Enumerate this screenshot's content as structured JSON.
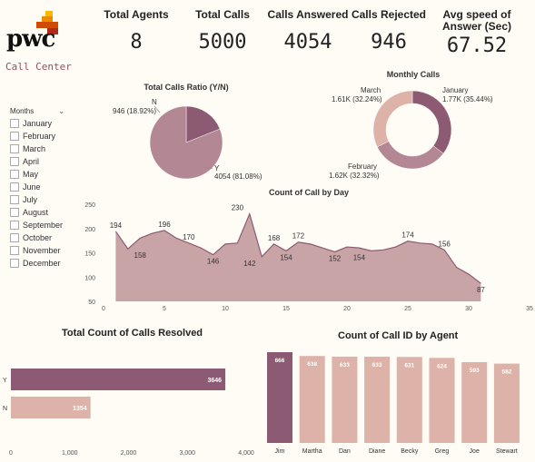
{
  "brand": {
    "logo_text": "pwc",
    "subtitle": "Call Center",
    "colors": {
      "red": "#d04a02",
      "orange": "#eb8c00",
      "yellow": "#ffb600",
      "dark": "#b02a1c"
    }
  },
  "kpis": [
    {
      "label": "Total Agents",
      "value": "8"
    },
    {
      "label": "Total Calls",
      "value": "5000"
    },
    {
      "label": "Calls Answered",
      "value": "4054"
    },
    {
      "label": "Calls Rejected",
      "value": "946"
    },
    {
      "label": "Avg speed of Answer (Sec)",
      "value": "67.52"
    }
  ],
  "slicer": {
    "title": "Months",
    "items": [
      "January",
      "February",
      "March",
      "April",
      "May",
      "June",
      "July",
      "August",
      "September",
      "October",
      "November",
      "December"
    ]
  },
  "colors": {
    "dark": "#8c5a72",
    "mid": "#b48795",
    "light": "#ddb2a8",
    "area": "#c9a4a6",
    "line": "#8c5a72"
  },
  "chart_data": [
    {
      "type": "pie",
      "title": "Total Calls Ratio (Y/N)",
      "categories": [
        "N",
        "Y"
      ],
      "values": [
        946,
        4054
      ],
      "labels": [
        "946 (18.92%)",
        "4054 (81.08%)"
      ]
    },
    {
      "type": "pie",
      "title": "Monthly Calls",
      "categories": [
        "January",
        "February",
        "March"
      ],
      "values": [
        1.77,
        1.62,
        1.61
      ],
      "labels": [
        "1.77K (35.44%)",
        "1.62K (32.32%)",
        "1.61K (32.24%)"
      ]
    },
    {
      "type": "area",
      "title": "Count of Call by Day",
      "x": [
        1,
        2,
        3,
        4,
        5,
        6,
        7,
        8,
        9,
        10,
        11,
        12,
        13,
        14,
        15,
        16,
        17,
        18,
        19,
        20,
        21,
        22,
        23,
        24,
        25,
        26,
        27,
        28,
        29,
        30,
        31
      ],
      "values": [
        194,
        158,
        180,
        190,
        196,
        180,
        170,
        160,
        146,
        168,
        170,
        230,
        142,
        168,
        154,
        172,
        168,
        160,
        152,
        162,
        160,
        154,
        156,
        162,
        174,
        170,
        168,
        156,
        120,
        106,
        87
      ],
      "labels": [
        "194",
        "158",
        "196",
        "170",
        "146",
        "230",
        "142",
        "168",
        "154",
        "172",
        "152",
        "154",
        "174",
        "156",
        "87"
      ],
      "label_x": [
        1,
        3,
        5,
        7,
        9,
        11,
        12,
        14,
        15,
        16,
        19,
        21,
        25,
        28,
        31
      ],
      "label_y": [
        194,
        158,
        196,
        170,
        146,
        230,
        142,
        168,
        154,
        172,
        152,
        154,
        174,
        156,
        87
      ],
      "xlim": [
        0,
        35
      ],
      "ylim": [
        50,
        250
      ],
      "xticks": [
        "0",
        "5",
        "10",
        "15",
        "20",
        "25",
        "30",
        "35"
      ],
      "yticks": [
        "50",
        "100",
        "150",
        "200",
        "250"
      ]
    },
    {
      "type": "bar",
      "orientation": "horizontal",
      "title": "Total Count of Calls Resolved",
      "categories": [
        "Y",
        "N"
      ],
      "values": [
        3646,
        1354
      ],
      "labels": [
        "3646",
        "1354"
      ],
      "xlim": [
        0,
        4000
      ],
      "xticks": [
        "0",
        "1,000",
        "2,000",
        "3,000",
        "4,000"
      ]
    },
    {
      "type": "bar",
      "title": "Count of Call ID by Agent",
      "categories": [
        "Jim",
        "Martha",
        "Dan",
        "Diane",
        "Becky",
        "Greg",
        "Joe",
        "Stewart"
      ],
      "values": [
        666,
        638,
        633,
        633,
        631,
        624,
        593,
        582
      ],
      "labels": [
        "666",
        "638",
        "633",
        "633",
        "631",
        "624",
        "593",
        "582"
      ]
    }
  ]
}
